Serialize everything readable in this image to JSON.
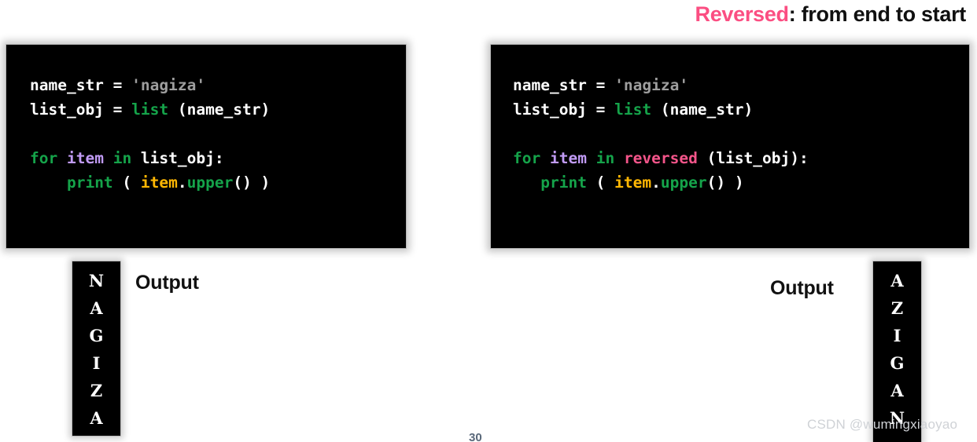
{
  "heading": {
    "highlight": "Reversed",
    "rest": ": from end to start",
    "highlight_color": "#fb4e82",
    "rest_color": "#101010"
  },
  "code_left": {
    "background": "#000000",
    "lines": [
      [
        {
          "text": "name_str = ",
          "token": "plain"
        },
        {
          "text": "'nagiza'",
          "token": "str"
        }
      ],
      [
        {
          "text": "list_obj = ",
          "token": "plain"
        },
        {
          "text": "list",
          "token": "fn"
        },
        {
          "text": " (name_str)",
          "token": "plain"
        }
      ],
      [],
      [
        {
          "text": "for",
          "token": "kw"
        },
        {
          "text": " ",
          "token": "plain"
        },
        {
          "text": "item",
          "token": "var"
        },
        {
          "text": " ",
          "token": "plain"
        },
        {
          "text": "in",
          "token": "kw"
        },
        {
          "text": " list_obj:",
          "token": "plain"
        }
      ],
      [
        {
          "text": "    ",
          "token": "plain"
        },
        {
          "text": "print",
          "token": "fn"
        },
        {
          "text": " ( ",
          "token": "plain"
        },
        {
          "text": "item",
          "token": "attr"
        },
        {
          "text": ".",
          "token": "plain"
        },
        {
          "text": "upper",
          "token": "fn"
        },
        {
          "text": "() )",
          "token": "plain"
        }
      ]
    ]
  },
  "code_right": {
    "background": "#000000",
    "lines": [
      [
        {
          "text": "name_str = ",
          "token": "plain"
        },
        {
          "text": "'nagiza'",
          "token": "str"
        }
      ],
      [
        {
          "text": "list_obj = ",
          "token": "plain"
        },
        {
          "text": "list",
          "token": "fn"
        },
        {
          "text": " (name_str)",
          "token": "plain"
        }
      ],
      [],
      [
        {
          "text": "for",
          "token": "kw"
        },
        {
          "text": " ",
          "token": "plain"
        },
        {
          "text": "item",
          "token": "var"
        },
        {
          "text": " ",
          "token": "plain"
        },
        {
          "text": "in",
          "token": "kw"
        },
        {
          "text": " ",
          "token": "plain"
        },
        {
          "text": "reversed",
          "token": "rev"
        },
        {
          "text": " (list_obj):",
          "token": "plain"
        }
      ],
      [
        {
          "text": "   ",
          "token": "plain"
        },
        {
          "text": "print",
          "token": "fn"
        },
        {
          "text": " ( ",
          "token": "plain"
        },
        {
          "text": "item",
          "token": "attr"
        },
        {
          "text": ".",
          "token": "plain"
        },
        {
          "text": "upper",
          "token": "fn"
        },
        {
          "text": "() )",
          "token": "plain"
        }
      ]
    ]
  },
  "output_left": {
    "label": "Output",
    "chars": [
      "N",
      "A",
      "G",
      "I",
      "Z",
      "A"
    ]
  },
  "output_right": {
    "label": "Output",
    "chars": [
      "A",
      "Z",
      "I",
      "G",
      "A",
      "N"
    ]
  },
  "page_number": "30",
  "watermark": "CSDN @wumingxiaoyao",
  "token_colors": {
    "plain": "#ffffff",
    "str": "#9e9e9e",
    "kw": "#15a34a",
    "fn": "#15a34a",
    "var": "#c19bf5",
    "attr": "#ffb703",
    "rev": "#f4558a"
  }
}
